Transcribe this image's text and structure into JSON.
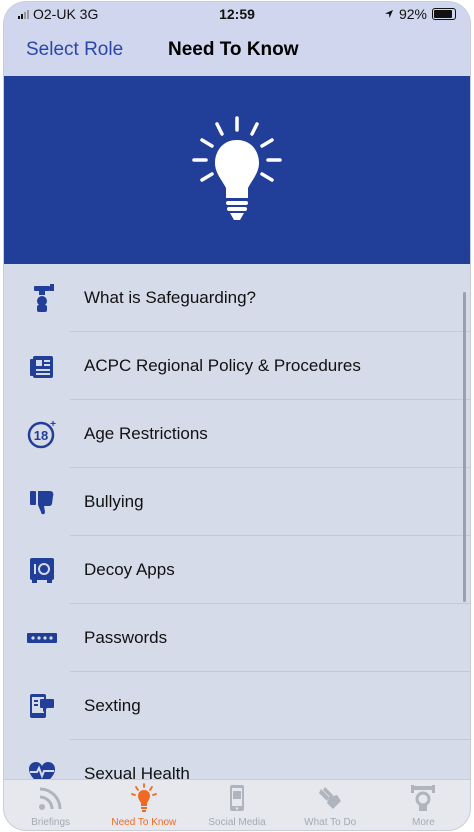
{
  "status_bar": {
    "carrier": "O2-UK 3G",
    "time": "12:59",
    "battery": "92%"
  },
  "nav": {
    "back_label": "Select Role",
    "title": "Need To Know"
  },
  "hero": {
    "icon": "lightbulb-icon"
  },
  "items": [
    {
      "label": "What is Safeguarding?",
      "icon": "safeguarding-icon"
    },
    {
      "label": "ACPC Regional Policy & Procedures",
      "icon": "document-icon"
    },
    {
      "label": "Age Restrictions",
      "icon": "age-18-icon"
    },
    {
      "label": "Bullying",
      "icon": "thumbs-down-icon"
    },
    {
      "label": "Decoy Apps",
      "icon": "safe-icon"
    },
    {
      "label": "Passwords",
      "icon": "password-icon"
    },
    {
      "label": "Sexting",
      "icon": "phone-chat-icon"
    },
    {
      "label": "Sexual Health",
      "icon": "heartbeat-icon"
    }
  ],
  "tabs": [
    {
      "label": "Briefings",
      "icon": "broadcast-icon",
      "active": false
    },
    {
      "label": "Need To Know",
      "icon": "lightbulb-icon",
      "active": true
    },
    {
      "label": "Social Media",
      "icon": "phone-icon",
      "active": false
    },
    {
      "label": "What To Do",
      "icon": "hands-icon",
      "active": false
    },
    {
      "label": "More",
      "icon": "more-icon",
      "active": false
    }
  ],
  "colors": {
    "accent": "#2a47a8",
    "hero": "#213e99",
    "active_tab": "#f06a24",
    "list_bg": "#d6dbea"
  }
}
